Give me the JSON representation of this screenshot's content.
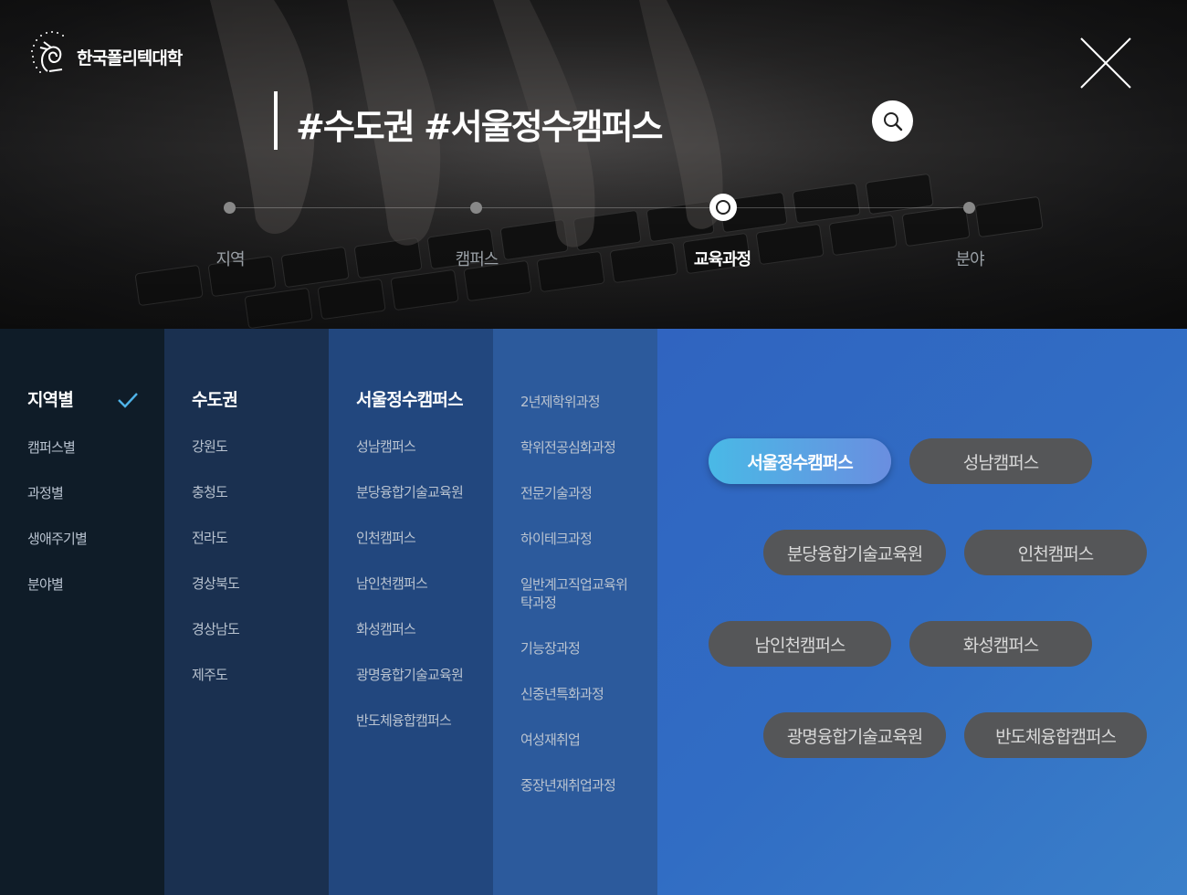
{
  "brand": {
    "name": "한국폴리텍대학"
  },
  "search": {
    "query": "#수도권 #서울정수캠퍼스"
  },
  "steps": [
    {
      "label": "지역",
      "active": false
    },
    {
      "label": "캠퍼스",
      "active": false
    },
    {
      "label": "교육과정",
      "active": true
    },
    {
      "label": "분야",
      "active": false
    }
  ],
  "filters": {
    "categories": [
      "지역별",
      "캠퍼스별",
      "과정별",
      "생애주기별",
      "분야별"
    ],
    "regions": [
      "수도권",
      "강원도",
      "충청도",
      "전라도",
      "경상북도",
      "경상남도",
      "제주도"
    ],
    "campuses": [
      "서울정수캠퍼스",
      "성남캠퍼스",
      "분당융합기술교육원",
      "인천캠퍼스",
      "남인천캠퍼스",
      "화성캠퍼스",
      "광명융합기술교육원",
      "반도체융합캠퍼스"
    ],
    "programs": [
      "2년제학위과정",
      "학위전공심화과정",
      "전문기술과정",
      "하이테크과정",
      "일반계고직업교육위탁과정",
      "기능장과정",
      "신중년특화과정",
      "여성재취업",
      "중장년재취업과정"
    ]
  },
  "chips": [
    "서울정수캠퍼스",
    "성남캠퍼스",
    "분당융합기술교육원",
    "인천캠퍼스",
    "남인천캠퍼스",
    "화성캠퍼스",
    "광명융합기술교육원",
    "반도체융합캠퍼스"
  ],
  "colors": {
    "accent_start": "#49b9e6",
    "accent_end": "#6a8ee0",
    "check": "#4fb3e8"
  }
}
